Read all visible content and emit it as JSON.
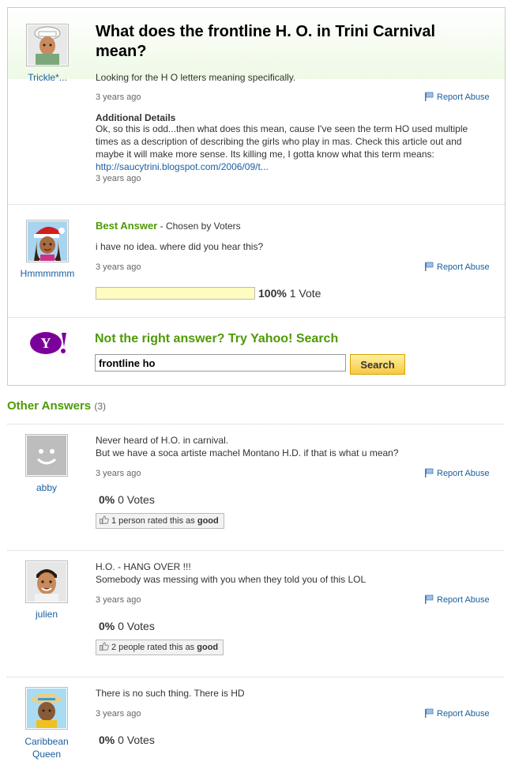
{
  "question": {
    "title": "What does the frontline H. O. in Trini Carnival mean?",
    "asker": "Trickle*...",
    "body": "Looking for the H O letters meaning specifically.",
    "time": "3 years ago",
    "report": "Report Abuse",
    "details_heading": "Additional Details",
    "details_text": "Ok, so this is odd...then what does this mean, cause I've seen the term HO used multiple times as a description of describing the girls who play in mas. Check this article out and maybe it will make more sense. Its killing me, I gotta know what this term means: ",
    "details_link": "http://saucytrini.blogspot.com/2006/09/t...",
    "details_time": "3 years ago"
  },
  "best_answer": {
    "label": "Best Answer",
    "chosen": " - Chosen by Voters",
    "user": "Hmmmmmm",
    "text": "i have no idea. where did you hear this?",
    "time": "3 years ago",
    "report": "Report Abuse",
    "vote_pct": "100%",
    "vote_count": "1 Vote",
    "vote_fraction": 1.0
  },
  "search": {
    "prompt": "Not the right answer? Try Yahoo! Search",
    "value": "frontline ho",
    "button": "Search",
    "logo": "Y!"
  },
  "other": {
    "heading": "Other Answers",
    "count": "(3)",
    "answers": [
      {
        "user": "abby",
        "line1": "Never heard of H.O. in carnival.",
        "line2": "But we have a soca artiste machel Montano H.D. if that is what u mean?",
        "time": "3 years ago",
        "report": "Report Abuse",
        "pct": "0%",
        "votes": "0 Votes",
        "rated_pre": "1 person rated this as ",
        "rated_word": "good"
      },
      {
        "user": "julien",
        "line1": "H.O. - HANG OVER !!!",
        "line2": "Somebody was messing with you when they told you of this LOL",
        "time": "3 years ago",
        "report": "Report Abuse",
        "pct": "0%",
        "votes": "0 Votes",
        "rated_pre": "2 people rated this as ",
        "rated_word": "good"
      },
      {
        "user1": "Caribbean",
        "user2": "Queen",
        "line1": "There is no such thing. There is HD",
        "time": "3 years ago",
        "report": "Report Abuse",
        "pct": "0%",
        "votes": "0 Votes"
      }
    ]
  },
  "icons": {
    "report": "flag-icon",
    "rated": "thumbs-up-icon"
  },
  "colors": {
    "green": "#4e9a06",
    "link": "#1a5fa0",
    "yahoo_purple": "#7b0099"
  }
}
